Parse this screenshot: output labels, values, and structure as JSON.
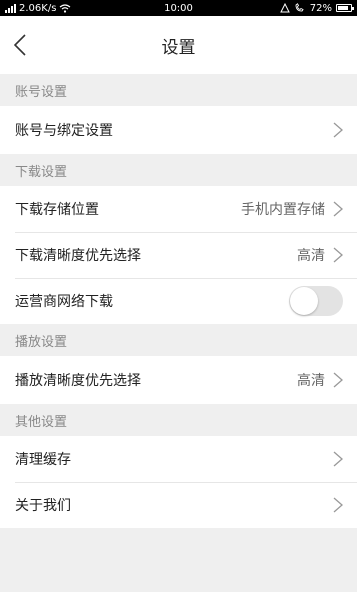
{
  "status_bar": {
    "network_speed": "2.06K/s",
    "time": "10:00",
    "battery": "72%"
  },
  "nav": {
    "title": "设置",
    "back_icon": "chevron-left-icon"
  },
  "sections": {
    "account": {
      "header": "账号设置",
      "binding_label": "账号与绑定设置"
    },
    "download": {
      "header": "下载设置",
      "location_label": "下载存储位置",
      "location_value": "手机内置存储",
      "quality_label": "下载清晰度优先选择",
      "quality_value": "高清",
      "carrier_label": "运营商网络下载",
      "carrier_enabled": false
    },
    "playback": {
      "header": "播放设置",
      "quality_label": "播放清晰度优先选择",
      "quality_value": "高清"
    },
    "other": {
      "header": "其他设置",
      "clear_cache_label": "清理缓存",
      "about_label": "关于我们"
    }
  },
  "colors": {
    "background": "#efefef",
    "row_background": "#ffffff",
    "section_text": "#888888",
    "toggle_off": "#e3e3e3"
  }
}
